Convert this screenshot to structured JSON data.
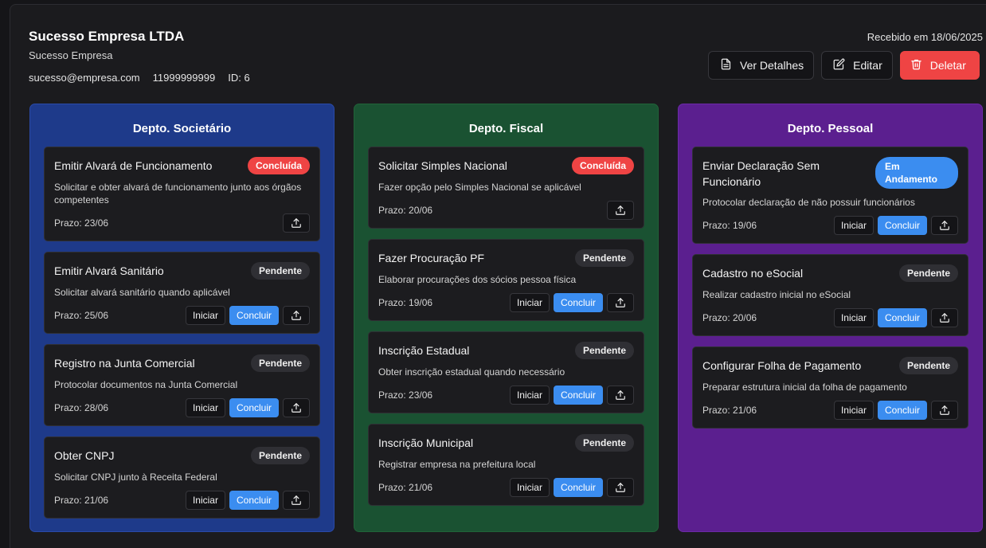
{
  "header": {
    "company_name": "Sucesso Empresa LTDA",
    "company_sub": "Sucesso Empresa",
    "email": "sucesso@empresa.com",
    "phone": "11999999999",
    "id_label": "ID: 6",
    "received": "Recebido em 18/06/2025",
    "details_label": "Ver Detalhes",
    "edit_label": "Editar",
    "delete_label": "Deletar"
  },
  "colors": {
    "societario": "#1e3a8a",
    "fiscal": "#1a5232",
    "pessoal": "#5b1f8f",
    "done": "#ef4444",
    "progress": "#3b8df0"
  },
  "labels": {
    "start": "Iniciar",
    "finish": "Concluir",
    "upload_icon": "upload-icon"
  },
  "columns": [
    {
      "title": "Depto. Societário",
      "cards": [
        {
          "title": "Emitir Alvará de Funcionamento",
          "status": "Concluída",
          "desc": "Solicitar e obter alvará de funcionamento junto aos órgãos competentes",
          "deadline": "Prazo: 23/06"
        },
        {
          "title": "Emitir Alvará Sanitário",
          "status": "Pendente",
          "desc": "Solicitar alvará sanitário quando aplicável",
          "deadline": "Prazo: 25/06"
        },
        {
          "title": "Registro na Junta Comercial",
          "status": "Pendente",
          "desc": "Protocolar documentos na Junta Comercial",
          "deadline": "Prazo: 28/06"
        },
        {
          "title": "Obter CNPJ",
          "status": "Pendente",
          "desc": "Solicitar CNPJ junto à Receita Federal",
          "deadline": "Prazo: 21/06"
        }
      ]
    },
    {
      "title": "Depto. Fiscal",
      "cards": [
        {
          "title": "Solicitar Simples Nacional",
          "status": "Concluída",
          "desc": "Fazer opção pelo Simples Nacional se aplicável",
          "deadline": "Prazo: 20/06"
        },
        {
          "title": "Fazer Procuração PF",
          "status": "Pendente",
          "desc": "Elaborar procurações dos sócios pessoa física",
          "deadline": "Prazo: 19/06"
        },
        {
          "title": "Inscrição Estadual",
          "status": "Pendente",
          "desc": "Obter inscrição estadual quando necessário",
          "deadline": "Prazo: 23/06"
        },
        {
          "title": "Inscrição Municipal",
          "status": "Pendente",
          "desc": "Registrar empresa na prefeitura local",
          "deadline": "Prazo: 21/06"
        }
      ]
    },
    {
      "title": "Depto. Pessoal",
      "cards": [
        {
          "title": "Enviar Declaração Sem Funcionário",
          "status": "Em Andamento",
          "desc": "Protocolar declaração de não possuir funcionários",
          "deadline": "Prazo: 19/06"
        },
        {
          "title": "Cadastro no eSocial",
          "status": "Pendente",
          "desc": "Realizar cadastro inicial no eSocial",
          "deadline": "Prazo: 20/06"
        },
        {
          "title": "Configurar Folha de Pagamento",
          "status": "Pendente",
          "desc": "Preparar estrutura inicial da folha de pagamento",
          "deadline": "Prazo: 21/06"
        }
      ]
    }
  ]
}
